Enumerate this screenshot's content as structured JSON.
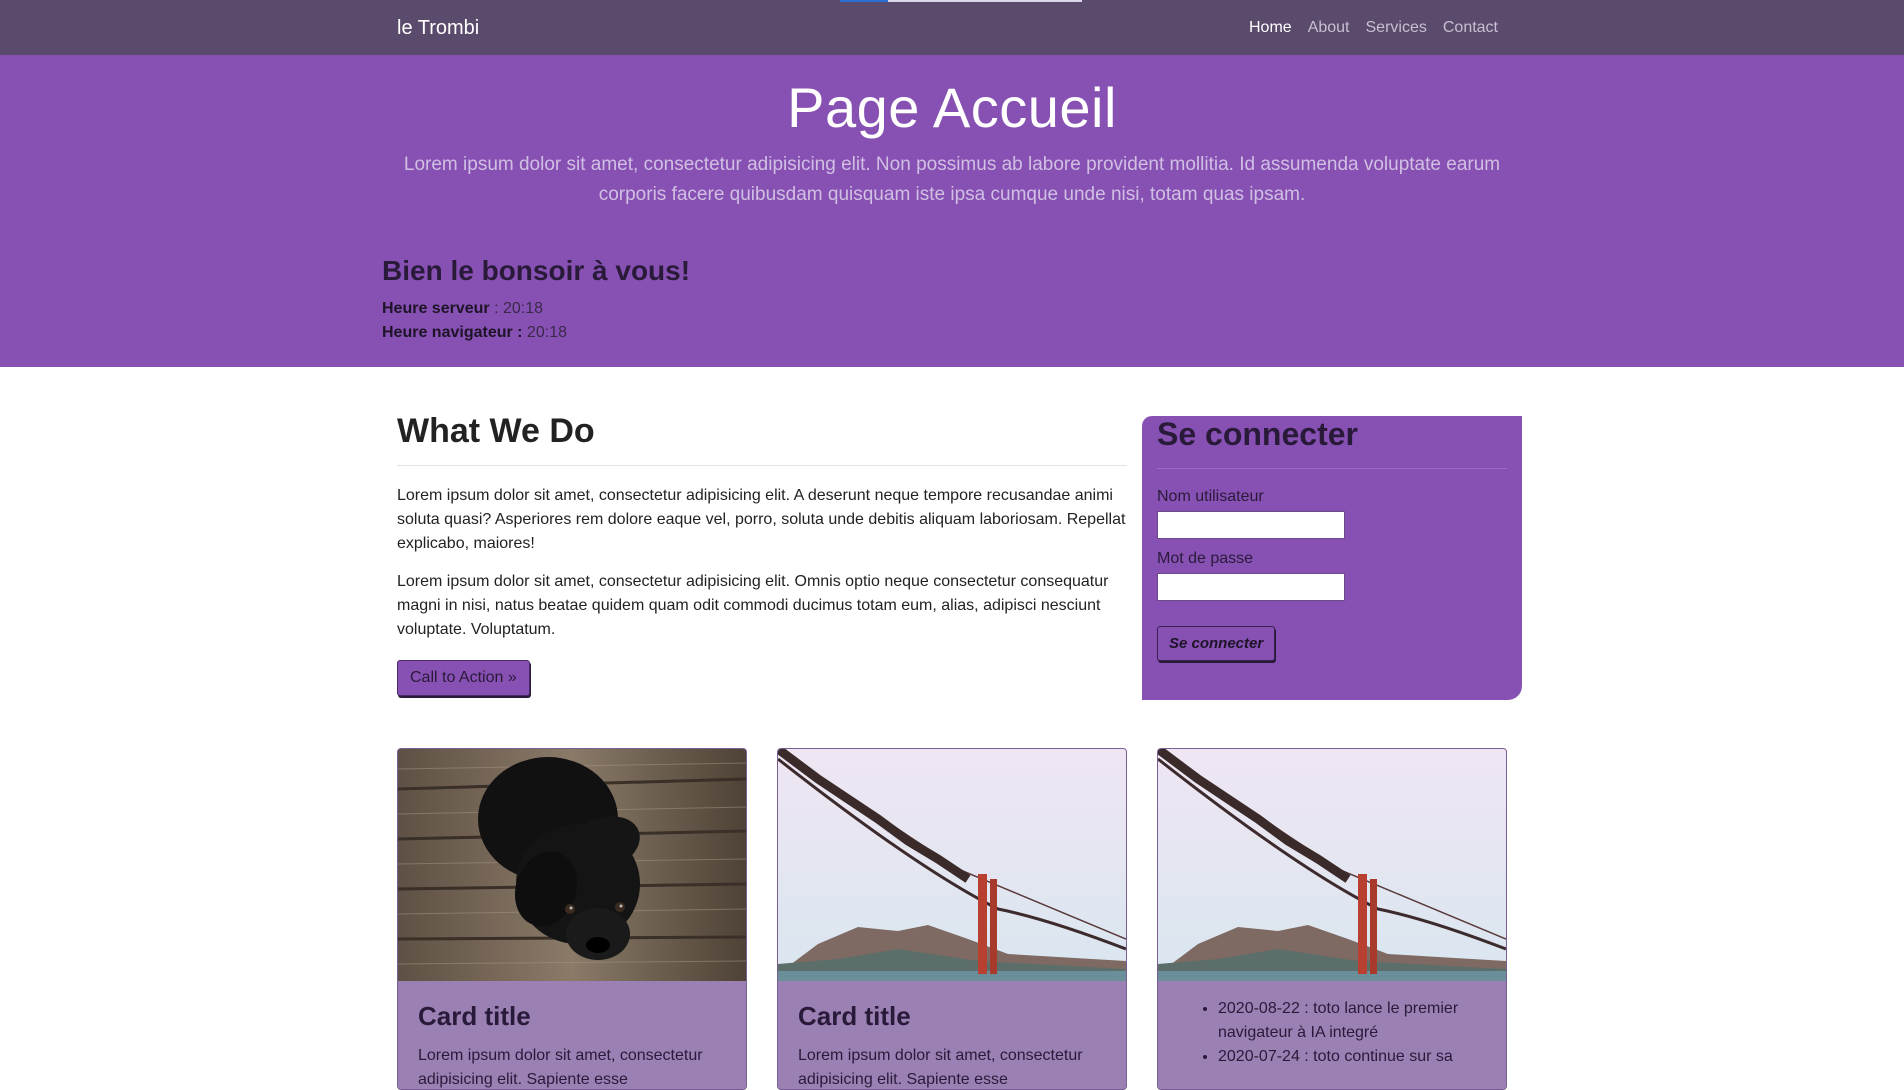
{
  "nav": {
    "brand": "le Trombi",
    "links": [
      {
        "label": "Home",
        "active": true
      },
      {
        "label": "About"
      },
      {
        "label": "Services"
      },
      {
        "label": "Contact"
      }
    ]
  },
  "hero": {
    "title": "Page Accueil",
    "lead": "Lorem ipsum dolor sit amet, consectetur adipisicing elit. Non possimus ab labore provident mollitia. Id assumenda voluptate earum corporis facere quibusdam quisquam iste ipsa cumque unde nisi, totam quas ipsam.",
    "greeting": "Bien le bonsoir à vous!",
    "server_time_label": "Heure serveur",
    "server_time_value": " : 20:18",
    "browser_time_label": "Heure navigateur :",
    "browser_time_value": " 20:18"
  },
  "main": {
    "heading": "What We Do",
    "paragraphs": [
      "Lorem ipsum dolor sit amet, consectetur adipisicing elit. A deserunt neque tempore recusandae animi soluta quasi? Asperiores rem dolore eaque vel, porro, soluta unde debitis aliquam laboriosam. Repellat explicabo, maiores!",
      "Lorem ipsum dolor sit amet, consectetur adipisicing elit. Omnis optio neque consectetur consequatur magni in nisi, natus beatae quidem quam odit commodi ducimus totam eum, alias, adipisci nesciunt voluptate. Voluptatum."
    ],
    "cta_label": "Call to Action »"
  },
  "login": {
    "title": "Se connecter",
    "username_label": "Nom utilisateur",
    "username_value": "",
    "password_label": "Mot de passe",
    "password_value": "",
    "submit_label": "Se connecter"
  },
  "cards": [
    {
      "image": "black-puppy-photo",
      "title": "Card title",
      "text": "Lorem ipsum dolor sit amet, consectetur adipisicing elit. Sapiente esse necessitatibus"
    },
    {
      "image": "golden-gate-bridge-photo",
      "title": "Card title",
      "text": "Lorem ipsum dolor sit amet, consectetur adipisicing elit. Sapiente esse necessitatibus"
    },
    {
      "image": "golden-gate-bridge-photo",
      "news": [
        "2020-08-22 : toto lance le premier navigateur à IA integré",
        "2020-07-24 : toto continue sur sa"
      ]
    }
  ],
  "colors": {
    "navbar": "#5a4a6b",
    "accent": "#8751b3",
    "card_body": "#9a80b3"
  }
}
